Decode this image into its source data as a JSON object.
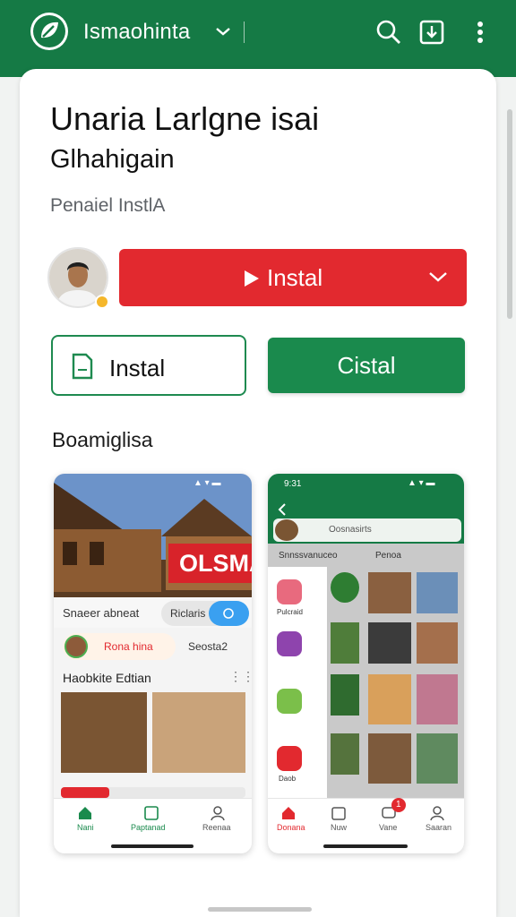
{
  "appbar": {
    "title": "Ismaohinta",
    "icons": [
      "leaf-logo-icon",
      "chevron-down-icon",
      "search-icon",
      "install-icon",
      "more-vert-icon"
    ]
  },
  "app": {
    "name": "Unaria Larlgne isai",
    "subtitle": "Glhahigain",
    "publisher": "Penaiel InstlA"
  },
  "actions": {
    "install_primary": "Instal",
    "install_secondary": "Instal",
    "green_button": "Cistal"
  },
  "section": {
    "screenshots_title": "Boamiglisa"
  },
  "screenshot1": {
    "status_icons": "▲ ▾ ▬",
    "hero_banner": "OLSMA",
    "search_label": "Snaeer abneat",
    "chip_text": "Riclaris",
    "profile_name": "Rona hina",
    "sweep_label": "Seosta2",
    "feed_title": "Haobkite Edtian",
    "nav": [
      "Nani",
      "Paptanad",
      "Reenaa"
    ]
  },
  "screenshot2": {
    "time": "9:31",
    "status_icons": "▲ ▾ ▬",
    "search_label": "Oosnasirts",
    "tab_left": "Snnssvanuceo",
    "tab_right": "Penoa",
    "drawer_items": [
      "Pulcraid",
      "",
      "",
      "Daob"
    ],
    "nav": [
      "Donana",
      "Nuw",
      "Vane",
      "Saaran"
    ],
    "badge_count": "1"
  },
  "colors": {
    "brand_green": "#157a45",
    "install_red": "#e2292f",
    "button_green": "#1a8a4d",
    "accent_blue": "#3aa0f0"
  }
}
